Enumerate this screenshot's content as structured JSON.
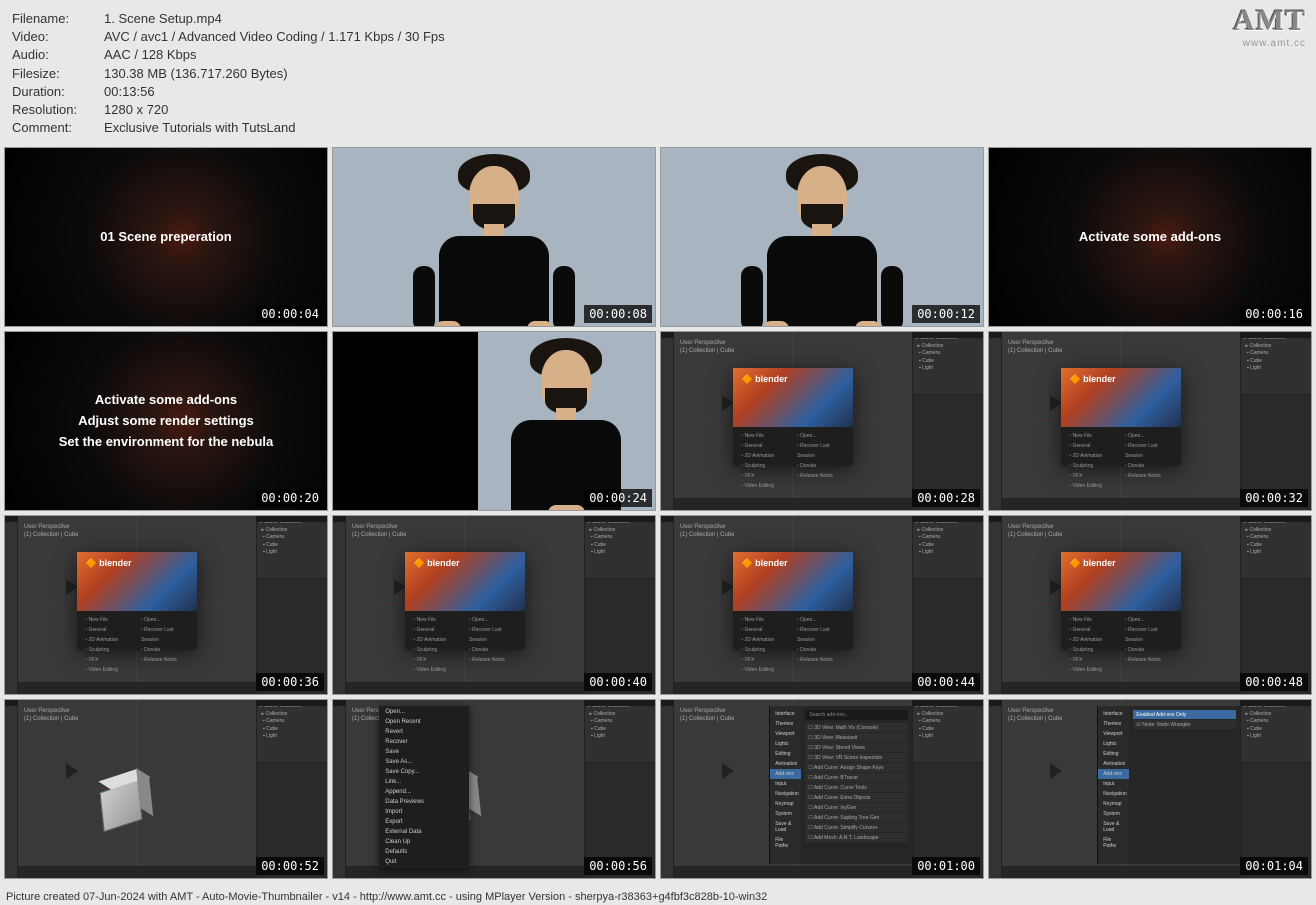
{
  "meta": {
    "filename_label": "Filename:",
    "filename": "1. Scene Setup.mp4",
    "video_label": "Video:",
    "video": "AVC / avc1 / Advanced Video Coding / 1.171 Kbps / 30 Fps",
    "audio_label": "Audio:",
    "audio": "AAC / 128 Kbps",
    "filesize_label": "Filesize:",
    "filesize": "130.38 MB (136.717.260 Bytes)",
    "duration_label": "Duration:",
    "duration": "00:13:56",
    "resolution_label": "Resolution:",
    "resolution": "1280 x 720",
    "comment_label": "Comment:",
    "comment": "Exclusive Tutorials with TutsLand"
  },
  "watermark": {
    "logo": "AMT",
    "url": "www.amt.cc"
  },
  "thumbs": [
    {
      "time": "00:00:04",
      "type": "nebula",
      "text1": "01 Scene preperation"
    },
    {
      "time": "00:00:08",
      "type": "presenter"
    },
    {
      "time": "00:00:12",
      "type": "presenter"
    },
    {
      "time": "00:00:16",
      "type": "nebula",
      "text1": "Activate some add-ons"
    },
    {
      "time": "00:00:20",
      "type": "nebula",
      "text1": "Activate some add-ons",
      "text2": "Adjust some render settings",
      "text3": "Set the environment for the nebula"
    },
    {
      "time": "00:00:24",
      "type": "split"
    },
    {
      "time": "00:00:28",
      "type": "blender-splash"
    },
    {
      "time": "00:00:32",
      "type": "blender-splash"
    },
    {
      "time": "00:00:36",
      "type": "blender-splash"
    },
    {
      "time": "00:00:40",
      "type": "blender-splash"
    },
    {
      "time": "00:00:44",
      "type": "blender-splash"
    },
    {
      "time": "00:00:48",
      "type": "blender-splash"
    },
    {
      "time": "00:00:52",
      "type": "blender-cube"
    },
    {
      "time": "00:00:56",
      "type": "blender-menu"
    },
    {
      "time": "00:01:00",
      "type": "blender-prefs"
    },
    {
      "time": "00:01:04",
      "type": "blender-prefs2"
    }
  ],
  "blender": {
    "logo": "blender",
    "viewport_text": "User Perspective\n(1) Collection | Cube",
    "splash_left": [
      "New File",
      "General",
      "2D Animation",
      "Sculpting",
      "VFX",
      "Video Editing"
    ],
    "splash_right": [
      "Open...",
      "Recover Last Session",
      "Donate",
      "Release Notes"
    ],
    "menu_items": [
      "Open...",
      "Open Recent",
      "Revert",
      "Recover",
      "Save",
      "Save As...",
      "Save Copy...",
      "Link...",
      "Append...",
      "Data Previews",
      "Import",
      "Export",
      "External Data",
      "Clean Up",
      "Defaults",
      "Quit"
    ],
    "prefs_cats": [
      "Interface",
      "Themes",
      "Viewport",
      "Lights",
      "Editing",
      "Animation",
      "Add-ons",
      "Input",
      "Navigation",
      "Keymap",
      "System",
      "Save & Load",
      "File Paths"
    ],
    "prefs_search": "Search add-ons...",
    "prefs_addons": [
      "☐ 3D View: Math Vis (Console)",
      "☐ 3D View: Measureit",
      "☐ 3D View: Stored Views",
      "☐ 3D View: VR Scene Inspection",
      "☐ Add Curve: Assign Shape Keys",
      "☐ Add Curve: BTracer",
      "☐ Add Curve: Curve Tools",
      "☐ Add Curve: Extra Objects",
      "☐ Add Curve: IvyGen",
      "☐ Add Curve: Sapling Tree Gen",
      "☐ Add Curve: Simplify Curves+",
      "☐ Add Mesh: A.N.T. Landscape"
    ],
    "prefs2_title": "Enabled Add-ons Only",
    "prefs2_item": "☑ Node: Node Wrangler"
  },
  "footer": "Picture created 07-Jun-2024 with AMT - Auto-Movie-Thumbnailer - v14 - http://www.amt.cc - using MPlayer Version - sherpya-r38363+g4fbf3c828b-10-win32"
}
